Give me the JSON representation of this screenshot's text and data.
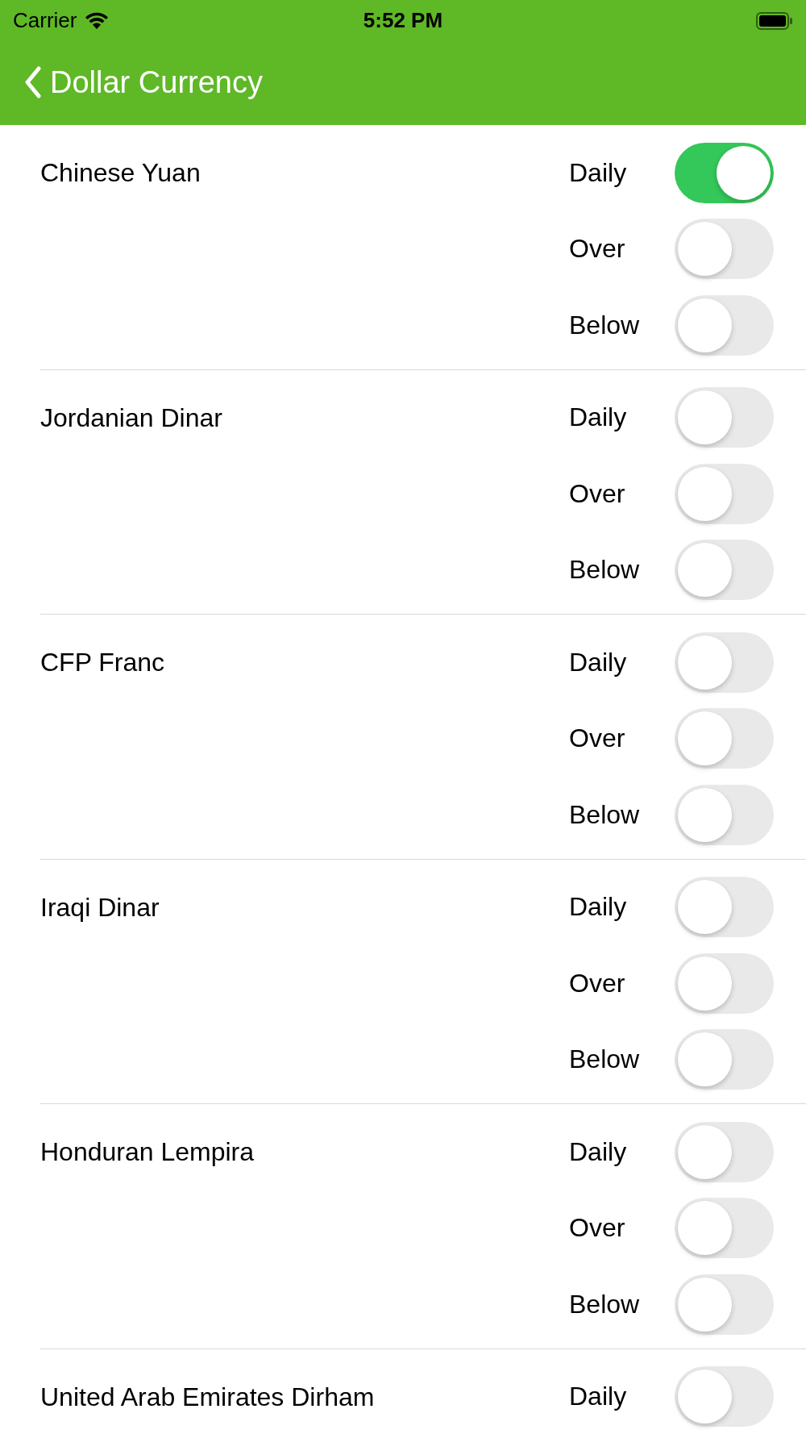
{
  "status_bar": {
    "carrier": "Carrier",
    "time": "5:52 PM"
  },
  "nav": {
    "title": "Dollar Currency"
  },
  "currencies": [
    {
      "name": "Chinese Yuan",
      "alerts": [
        {
          "label": "Daily",
          "on": true
        },
        {
          "label": "Over",
          "on": false
        },
        {
          "label": "Below",
          "on": false
        }
      ]
    },
    {
      "name": "Jordanian Dinar",
      "alerts": [
        {
          "label": "Daily",
          "on": false
        },
        {
          "label": "Over",
          "on": false
        },
        {
          "label": "Below",
          "on": false
        }
      ]
    },
    {
      "name": "CFP Franc",
      "alerts": [
        {
          "label": "Daily",
          "on": false
        },
        {
          "label": "Over",
          "on": false
        },
        {
          "label": "Below",
          "on": false
        }
      ]
    },
    {
      "name": "Iraqi Dinar",
      "alerts": [
        {
          "label": "Daily",
          "on": false
        },
        {
          "label": "Over",
          "on": false
        },
        {
          "label": "Below",
          "on": false
        }
      ]
    },
    {
      "name": "Honduran Lempira",
      "alerts": [
        {
          "label": "Daily",
          "on": false
        },
        {
          "label": "Over",
          "on": false
        },
        {
          "label": "Below",
          "on": false
        }
      ]
    },
    {
      "name": "United Arab Emirates Dirham",
      "alerts": [
        {
          "label": "Daily",
          "on": false
        }
      ]
    }
  ]
}
